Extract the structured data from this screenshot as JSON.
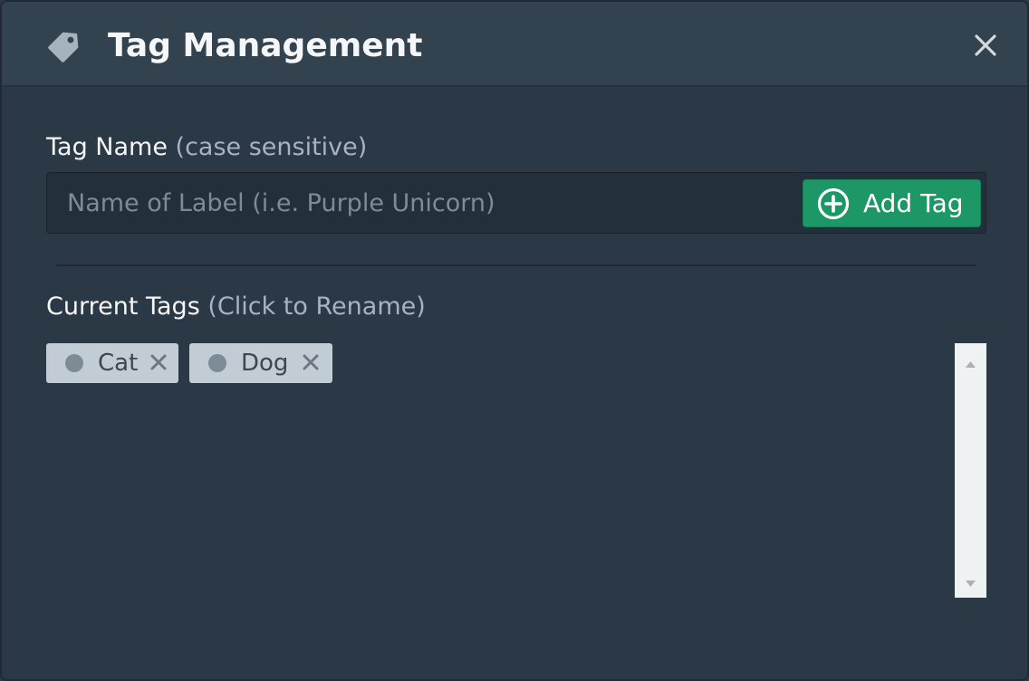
{
  "header": {
    "icon": "tag-icon",
    "title": "Tag Management",
    "close_icon": "close-icon"
  },
  "form": {
    "label": "Tag Name",
    "label_hint": "(case sensitive)",
    "input_value": "",
    "input_placeholder": "Name of Label (i.e. Purple Unicorn)",
    "add_button_icon": "plus-circle-icon",
    "add_button_label": "Add Tag"
  },
  "tags": {
    "label": "Current Tags",
    "label_hint": "(Click to Rename)",
    "items": [
      {
        "name": "Cat",
        "remove_icon": "remove-icon"
      },
      {
        "name": "Dog",
        "remove_icon": "remove-icon"
      }
    ]
  },
  "colors": {
    "modal_background": "#2b3846",
    "header_background": "#33424f",
    "accent_green": "#1d9766",
    "chip_background": "#c2ccd4",
    "chip_dot": "#7d8b96"
  }
}
